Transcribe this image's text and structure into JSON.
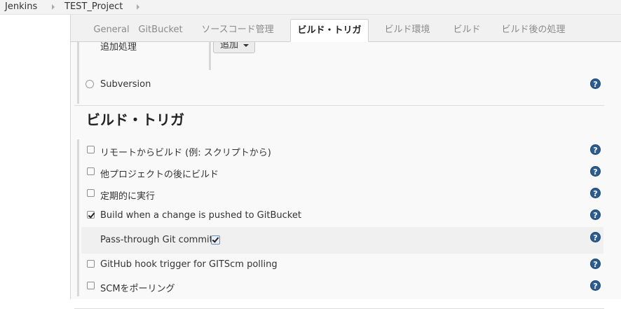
{
  "breadcrumb": {
    "items": [
      "Jenkins",
      "TEST_Project"
    ]
  },
  "tabs": [
    {
      "label": "General",
      "active": false
    },
    {
      "label": "GitBucket",
      "active": false
    },
    {
      "label": "ソースコード管理",
      "active": false
    },
    {
      "label": "ビルド・トリガ",
      "active": true
    },
    {
      "label": "ビルド環境",
      "active": false
    },
    {
      "label": "ビルド",
      "active": false
    },
    {
      "label": "ビルド後の処理",
      "active": false
    }
  ],
  "scm": {
    "additional_label": "追加処理",
    "add_button_label": "追加",
    "subversion_label": "Subversion"
  },
  "build_triggers": {
    "title": "ビルド・トリガ",
    "options": [
      {
        "label": "リモートからビルド (例: スクリプトから)",
        "checked": false
      },
      {
        "label": "他プロジェクトの後にビルド",
        "checked": false
      },
      {
        "label": "定期的に実行",
        "checked": false
      },
      {
        "label": "Build when a change is pushed to GitBucket",
        "checked": true
      },
      {
        "label": "Pass-through Git commit",
        "checked": true
      },
      {
        "label": "GitHub hook trigger for GITScm polling",
        "checked": false
      },
      {
        "label": "SCMをポーリング",
        "checked": false
      }
    ]
  },
  "help_icon_text": "?",
  "colors": {
    "help_icon": "#2d5d8f",
    "active_tab_bg": "#ffffff",
    "panel_bg": "#f9f9f9"
  }
}
